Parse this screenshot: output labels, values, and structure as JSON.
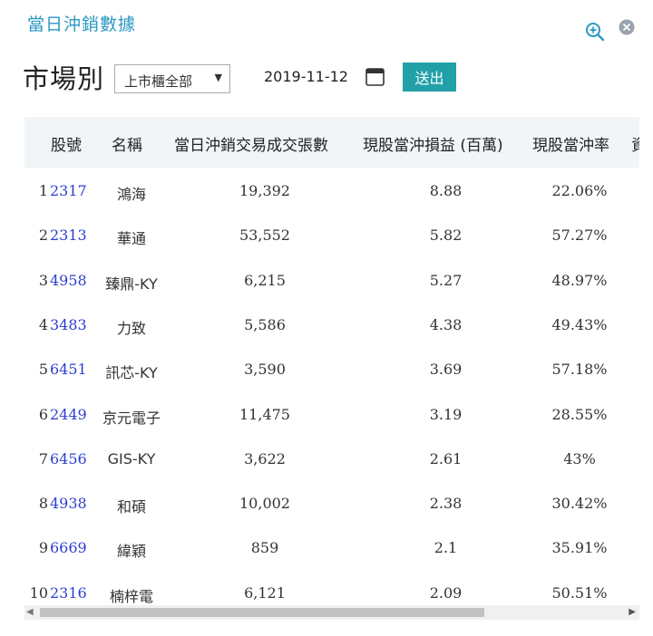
{
  "widget": {
    "title": "當日沖銷數據"
  },
  "filters": {
    "market_label": "市場別",
    "market_value": "上市櫃全部",
    "date": "2019-11-12",
    "submit_label": "送出"
  },
  "table": {
    "headers": {
      "code": "股號",
      "name": "名稱",
      "volume": "當日沖銷交易成交張數",
      "profit": "現股當沖損益 (百萬)",
      "rate": "現股當沖率",
      "extra": "資"
    },
    "rows": [
      {
        "idx": "1",
        "code": "2317",
        "name": "鴻海",
        "volume": "19,392",
        "profit": "8.88",
        "rate": "22.06%"
      },
      {
        "idx": "2",
        "code": "2313",
        "name": "華通",
        "volume": "53,552",
        "profit": "5.82",
        "rate": "57.27%"
      },
      {
        "idx": "3",
        "code": "4958",
        "name": "臻鼎-KY",
        "volume": "6,215",
        "profit": "5.27",
        "rate": "48.97%"
      },
      {
        "idx": "4",
        "code": "3483",
        "name": "力致",
        "volume": "5,586",
        "profit": "4.38",
        "rate": "49.43%"
      },
      {
        "idx": "5",
        "code": "6451",
        "name": "訊芯-KY",
        "volume": "3,590",
        "profit": "3.69",
        "rate": "57.18%"
      },
      {
        "idx": "6",
        "code": "2449",
        "name": "京元電子",
        "volume": "11,475",
        "profit": "3.19",
        "rate": "28.55%"
      },
      {
        "idx": "7",
        "code": "6456",
        "name": "GIS-KY",
        "volume": "3,622",
        "profit": "2.61",
        "rate": "43%"
      },
      {
        "idx": "8",
        "code": "4938",
        "name": "和碩",
        "volume": "10,002",
        "profit": "2.38",
        "rate": "30.42%"
      },
      {
        "idx": "9",
        "code": "6669",
        "name": "緯穎",
        "volume": "859",
        "profit": "2.1",
        "rate": "35.91%"
      },
      {
        "idx": "10",
        "code": "2316",
        "name": "楠梓電",
        "volume": "6,121",
        "profit": "2.09",
        "rate": "50.51%"
      }
    ]
  },
  "icons": {
    "zoom": "zoom-in-icon",
    "close": "close-icon",
    "calendar": "calendar-icon"
  },
  "colors": {
    "title": "#2a98c4",
    "submit_bg": "#21a0a8",
    "code_link": "#2a3fcf",
    "header_bg": "#f1f5f8"
  }
}
